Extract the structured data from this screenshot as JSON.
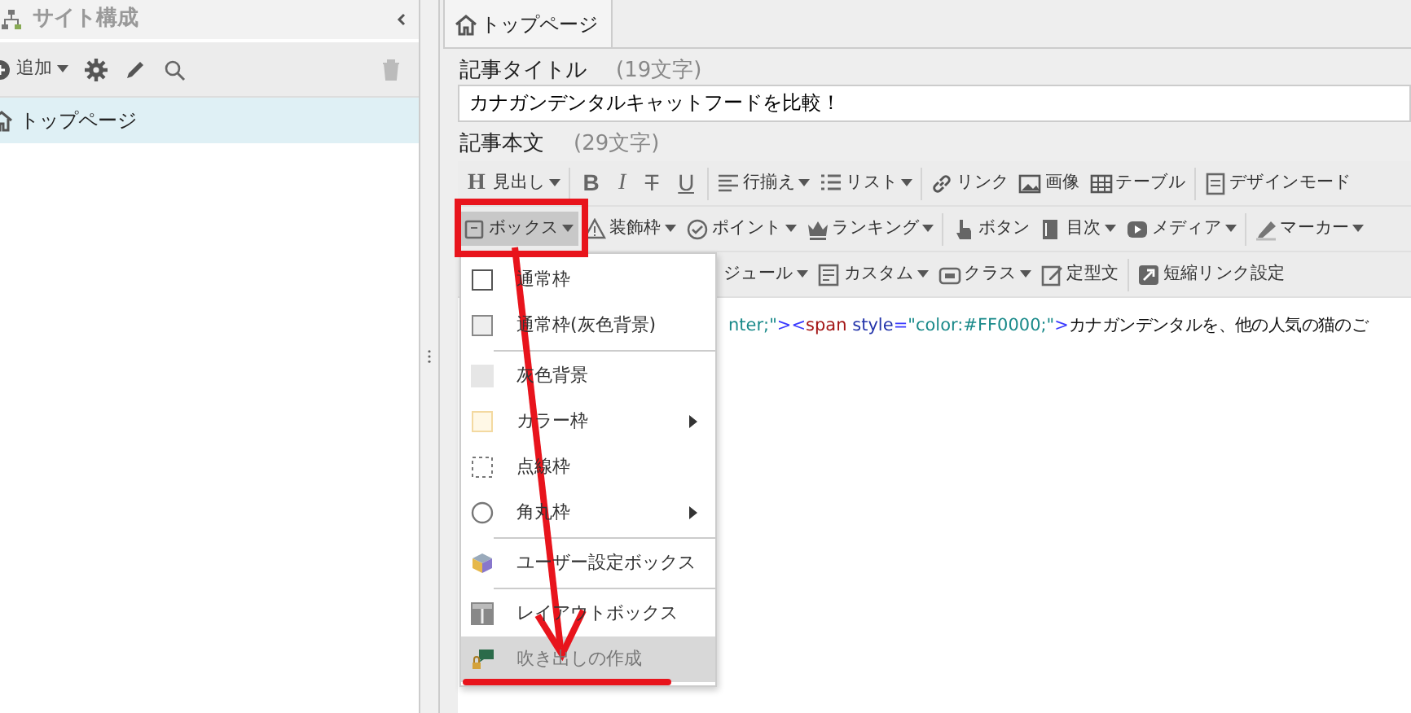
{
  "sidebar": {
    "title": "サイト構成",
    "add_label": "追加",
    "tree": [
      {
        "label": "トップページ",
        "selected": true
      }
    ]
  },
  "tab": {
    "label": "トップページ",
    "selected": true
  },
  "title_field": {
    "label": "記事タイトル",
    "count": "(19文字)",
    "value": "カナガンデンタルキャットフードを比較！"
  },
  "body_field": {
    "label": "記事本文",
    "count": "(29文字)"
  },
  "toolbar_rows": [
    [
      {
        "kind": "heading",
        "glyph": "H",
        "label": "見出し",
        "caret": true,
        "sep": false
      },
      {
        "kind": "bold",
        "glyph": "B",
        "caret": false,
        "sep": true
      },
      {
        "kind": "italic",
        "glyph": "I",
        "caret": false,
        "sep": false
      },
      {
        "kind": "strike",
        "glyph": "T",
        "caret": false,
        "sep": false
      },
      {
        "kind": "underline",
        "glyph": "U",
        "caret": false,
        "sep": false
      },
      {
        "kind": "align",
        "label": "行揃え",
        "caret": true,
        "sep": true
      },
      {
        "kind": "list",
        "label": "リスト",
        "caret": true,
        "sep": false
      },
      {
        "kind": "link",
        "label": "リンク",
        "caret": false,
        "sep": true
      },
      {
        "kind": "image",
        "label": "画像",
        "caret": false,
        "sep": false
      },
      {
        "kind": "table",
        "label": "テーブル",
        "caret": false,
        "sep": false
      },
      {
        "kind": "design",
        "label": "デザインモード",
        "caret": false,
        "sep": true
      }
    ],
    [
      {
        "kind": "box",
        "label": "ボックス",
        "caret": true,
        "sep": false,
        "selected": true
      },
      {
        "kind": "warning",
        "label": "装飾枠",
        "caret": true,
        "sep": false,
        "selected": false
      },
      {
        "kind": "check",
        "label": "ポイント",
        "caret": true,
        "sep": false,
        "selected": false
      },
      {
        "kind": "crown",
        "label": "ランキング",
        "caret": true,
        "sep": false,
        "selected": false
      },
      {
        "kind": "hand",
        "label": "ボタン",
        "caret": false,
        "sep": true,
        "selected": false
      },
      {
        "kind": "book",
        "label": "目次",
        "caret": true,
        "sep": false,
        "selected": false
      },
      {
        "kind": "play",
        "label": "メディア",
        "caret": true,
        "sep": false,
        "selected": false
      },
      {
        "kind": "marker",
        "label": "マーカー",
        "caret": true,
        "sep": true,
        "selected": false
      }
    ],
    [
      {
        "kind": "text",
        "label": "ジュール",
        "caret": true,
        "sep": false
      },
      {
        "kind": "custom",
        "label": "カスタム",
        "caret": true,
        "sep": false
      },
      {
        "kind": "class",
        "label": "クラス",
        "caret": true,
        "sep": false
      },
      {
        "kind": "edit",
        "label": "定型文",
        "caret": false,
        "sep": false
      },
      {
        "kind": "shortlink",
        "label": "短縮リンク設定",
        "caret": false,
        "sep": true
      }
    ]
  ],
  "code_line": [
    {
      "kind": "value",
      "text": "nter;\""
    },
    {
      "kind": "punct",
      "text": ">"
    },
    {
      "kind": "punct",
      "text": "<"
    },
    {
      "kind": "tag",
      "text": "span"
    },
    {
      "kind": "attr",
      "text": " style"
    },
    {
      "kind": "punct",
      "text": "="
    },
    {
      "kind": "value",
      "text": "\"color:#FF0000;\""
    },
    {
      "kind": "punct",
      "text": ">"
    },
    {
      "kind": "text",
      "text": "カナガンデンタルを、他の人気の猫のご"
    }
  ],
  "box_menu": [
    {
      "kind": "plain",
      "label": "通常枠",
      "submenu": false,
      "sep": false,
      "selected": false
    },
    {
      "kind": "plain-gray",
      "label": "通常枠(灰色背景)",
      "submenu": false,
      "sep": false,
      "selected": false
    },
    {
      "kind": "gray",
      "label": "灰色背景",
      "submenu": false,
      "sep": true,
      "selected": false
    },
    {
      "kind": "color",
      "label": "カラー枠",
      "submenu": true,
      "sep": false,
      "selected": false
    },
    {
      "kind": "dotted",
      "label": "点線枠",
      "submenu": false,
      "sep": false,
      "selected": false
    },
    {
      "kind": "round",
      "label": "角丸枠",
      "submenu": true,
      "sep": false,
      "selected": false
    },
    {
      "kind": "user",
      "label": "ユーザー設定ボックス",
      "submenu": false,
      "sep": true,
      "selected": false
    },
    {
      "kind": "layout",
      "label": "レイアウトボックス",
      "submenu": false,
      "sep": true,
      "selected": false
    },
    {
      "kind": "balloon",
      "label": "吹き出しの作成",
      "submenu": false,
      "sep": false,
      "selected": true
    }
  ]
}
